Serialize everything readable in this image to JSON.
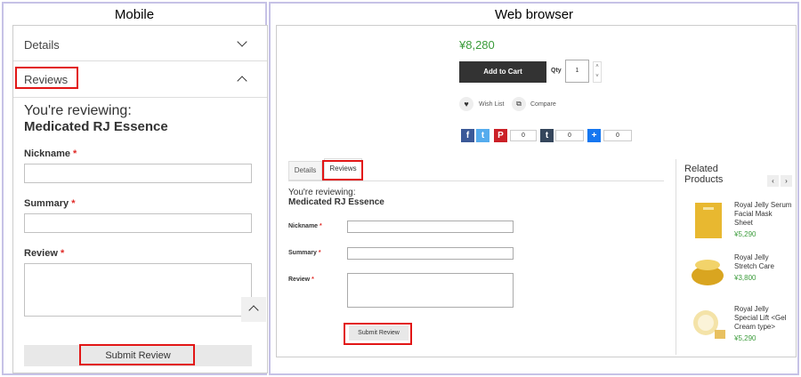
{
  "mobile": {
    "title": "Mobile",
    "details_label": "Details",
    "reviews_label": "Reviews",
    "reviewing_prefix": "You're reviewing:",
    "product_name": "Medicated RJ Essence",
    "nickname_label": "Nickname",
    "summary_label": "Summary",
    "review_label": "Review",
    "required_mark": "*",
    "submit_label": "Submit Review"
  },
  "web": {
    "title": "Web browser",
    "price": "¥8,280",
    "add_to_cart": "Add to Cart",
    "qty_label": "Qty",
    "qty_value": "1",
    "wishlist": "Wish List",
    "compare": "Compare",
    "share_counts": [
      "0",
      "0",
      "0"
    ],
    "tabs": [
      "Details",
      "Reviews"
    ],
    "reviewing_prefix": "You're reviewing:",
    "product_name": "Medicated RJ Essence",
    "nickname_label": "Nickname",
    "summary_label": "Summary",
    "review_label": "Review",
    "required_mark": "*",
    "submit_label": "Submit Review",
    "related_title_1": "Related",
    "related_title_2": "Products",
    "related": [
      {
        "name_lines": [
          "Royal Jelly Serum",
          "Facial Mask",
          "Sheet"
        ],
        "price": "¥5,290"
      },
      {
        "name_lines": [
          "Royal Jelly",
          "Stretch Care"
        ],
        "price": "¥3,800"
      },
      {
        "name_lines": [
          "Royal Jelly",
          "Special Lift <Gel",
          "Cream type>"
        ],
        "price": "¥5,290"
      }
    ]
  },
  "colors": {
    "border": "#c6c2e6",
    "highlight": "#e21616",
    "button_dark": "#333333",
    "price_green": "#3a9b3a"
  }
}
